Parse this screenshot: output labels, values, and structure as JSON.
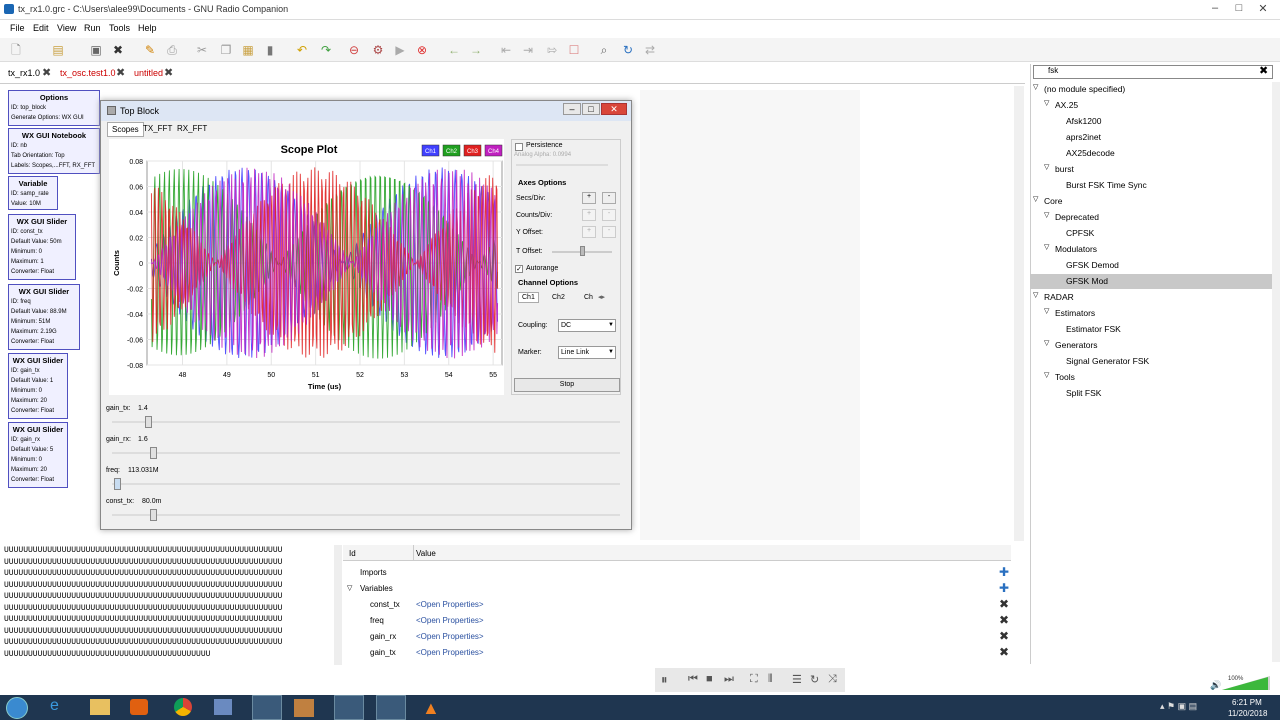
{
  "window": {
    "title": "tx_rx1.0.grc - C:\\Users\\alee99\\Documents - GNU Radio Companion"
  },
  "menu": [
    "File",
    "Edit",
    "View",
    "Run",
    "Tools",
    "Help"
  ],
  "tabs": [
    {
      "label": "tx_rx1.0",
      "color": "#000"
    },
    {
      "label": "tx_osc.test1.0",
      "color": "#c00"
    },
    {
      "label": "untitled",
      "color": "#c00"
    }
  ],
  "blocks": {
    "options": {
      "title": "Options",
      "lines": [
        "ID: top_block",
        "Generate Options: WX GUI"
      ]
    },
    "notebook": {
      "title": "WX GUI Notebook",
      "lines": [
        "ID: nb",
        "Tab Orientation: Top",
        "Labels: Scopes,...FFT, RX_FFT"
      ]
    },
    "variable": {
      "title": "Variable",
      "lines": [
        "ID: samp_rate",
        "Value: 10M"
      ]
    },
    "slider1": {
      "title": "WX GUI Slider",
      "lines": [
        "ID: const_tx",
        "Default Value: 50m",
        "Minimum: 0",
        "Maximum: 1",
        "Converter: Float"
      ]
    },
    "slider2": {
      "title": "WX GUI Slider",
      "lines": [
        "ID: freq",
        "Default Value: 88.9M",
        "Minimum: 51M",
        "Maximum: 2.19G",
        "Converter: Float"
      ]
    },
    "slider3": {
      "title": "WX GUI Slider",
      "lines": [
        "ID: gain_tx",
        "Default Value: 1",
        "Minimum: 0",
        "Maximum: 20",
        "Converter: Float"
      ]
    },
    "slider4": {
      "title": "WX GUI Slider",
      "lines": [
        "ID: gain_rx",
        "Default Value: 5",
        "Minimum: 0",
        "Maximum: 20",
        "Converter: Float"
      ]
    }
  },
  "dialog": {
    "title": "Top Block",
    "tabs": [
      "Scopes",
      "TX_FFT",
      "RX_FFT"
    ],
    "persistence": "Persistence",
    "analog_alpha": "Analog Alpha: 0.0994",
    "axes_options": "Axes Options",
    "secs_div": "Secs/Div:",
    "counts_div": "Counts/Div:",
    "y_offset": "Y Offset:",
    "t_offset": "T Offset:",
    "autorange": "Autorange",
    "channel_options": "Channel Options",
    "ch_tabs": [
      "Ch1",
      "Ch2",
      "Ch"
    ],
    "coupling_label": "Coupling:",
    "coupling_value": "DC",
    "marker_label": "Marker:",
    "marker_value": "Line Link",
    "stop": "Stop",
    "sliders": [
      {
        "label": "gain_tx:",
        "value": "1.4",
        "pos": 0.07
      },
      {
        "label": "gain_rx:",
        "value": "1.6",
        "pos": 0.08
      },
      {
        "label": "freq:",
        "value": "113.031M",
        "pos": 0.01
      },
      {
        "label": "const_tx:",
        "value": "80.0m",
        "pos": 0.08
      }
    ]
  },
  "chart_data": {
    "type": "line",
    "title": "Scope Plot",
    "xlabel": "Time (us)",
    "ylabel": "Counts",
    "xlim": [
      47.2,
      55.2
    ],
    "ylim": [
      -0.08,
      0.08
    ],
    "xticks": [
      "48",
      "49",
      "50",
      "51",
      "52",
      "53",
      "54",
      "55"
    ],
    "yticks": [
      "0.08",
      "0.06",
      "0.04",
      "0.02",
      "0",
      "-0.02",
      "-0.04",
      "-0.06",
      "-0.08"
    ],
    "legend": [
      "Ch1",
      "Ch2",
      "Ch3",
      "Ch4"
    ],
    "colors": [
      "#4040ff",
      "#20a020",
      "#e02020",
      "#c020c0"
    ],
    "grid": true
  },
  "search": {
    "value": "fsk"
  },
  "tree": [
    {
      "label": "(no module specified)",
      "level": 0,
      "arrow": true
    },
    {
      "label": "AX.25",
      "level": 1,
      "arrow": true
    },
    {
      "label": "Afsk1200",
      "level": 2
    },
    {
      "label": "aprs2inet",
      "level": 2
    },
    {
      "label": "AX25decode",
      "level": 2
    },
    {
      "label": "burst",
      "level": 1,
      "arrow": true
    },
    {
      "label": "Burst FSK Time Sync",
      "level": 2
    },
    {
      "label": "Core",
      "level": 0,
      "arrow": true
    },
    {
      "label": "Deprecated",
      "level": 1,
      "arrow": true
    },
    {
      "label": "CPFSK",
      "level": 2
    },
    {
      "label": "Modulators",
      "level": 1,
      "arrow": true
    },
    {
      "label": "GFSK Demod",
      "level": 2
    },
    {
      "label": "GFSK Mod",
      "level": 2,
      "selected": true
    },
    {
      "label": "RADAR",
      "level": 0,
      "arrow": true
    },
    {
      "label": "Estimators",
      "level": 1,
      "arrow": true
    },
    {
      "label": "Estimator FSK",
      "level": 2
    },
    {
      "label": "Generators",
      "level": 1,
      "arrow": true
    },
    {
      "label": "Signal Generator FSK",
      "level": 2
    },
    {
      "label": "Tools",
      "level": 1,
      "arrow": true
    },
    {
      "label": "Split FSK",
      "level": 2
    }
  ],
  "console": {
    "line": "UUUUUUUUUUUUUUUUUUUUUUUUUUUUUUUUUUUUUUUUUUUUUUUUUUUUUUUUUU",
    "last": "UUUUUUUUUUUUUUUUUUUUUUUUUUUUUUUUUUUUUUUUUUU"
  },
  "vars": {
    "col_id": "Id",
    "col_value": "Value",
    "imports": "Imports",
    "variables": "Variables",
    "rows": [
      {
        "id": "const_tx",
        "value": "<Open Properties>"
      },
      {
        "id": "freq",
        "value": "<Open Properties>"
      },
      {
        "id": "gain_rx",
        "value": "<Open Properties>"
      },
      {
        "id": "gain_tx",
        "value": "<Open Properties>"
      }
    ]
  },
  "clock": {
    "time": "6:21 PM",
    "date": "11/20/2018",
    "zoom": "100%"
  }
}
